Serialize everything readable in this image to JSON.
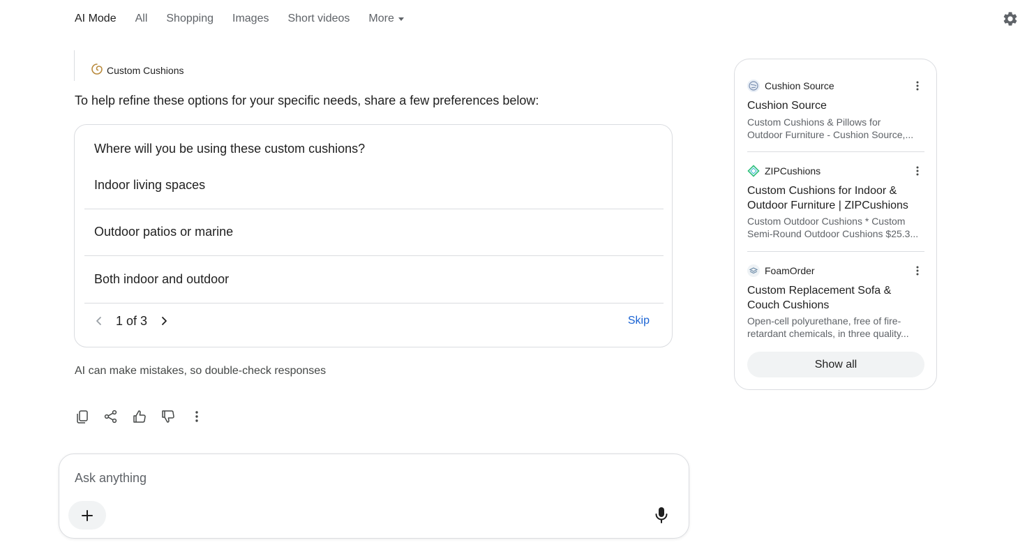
{
  "nav": {
    "tabs": [
      {
        "label": "AI Mode"
      },
      {
        "label": "All"
      },
      {
        "label": "Shopping"
      },
      {
        "label": "Images"
      },
      {
        "label": "Short videos"
      },
      {
        "label": "More"
      }
    ]
  },
  "source_chip": {
    "label": "Custom Cushions"
  },
  "intro_text": "To help refine these options for your specific needs, share a few preferences below:",
  "question": {
    "title": "Where will you be using these custom cushions?",
    "options": [
      {
        "label": "Indoor living spaces"
      },
      {
        "label": "Outdoor patios or marine"
      },
      {
        "label": "Both indoor and outdoor"
      }
    ],
    "pager_text": "1 of 3",
    "skip_label": "Skip"
  },
  "disclaimer": "AI can make mistakes, so double-check responses",
  "ask": {
    "placeholder": "Ask anything"
  },
  "sidebar": {
    "results": [
      {
        "source": "Cushion Source",
        "title": "Cushion Source",
        "snippet_line1": "Custom Cushions & Pillows for",
        "snippet_line2": "Outdoor Furniture - Cushion Source,...",
        "favicon": "globe-icon"
      },
      {
        "source": "ZIPCushions",
        "title": "Custom Cushions for Indoor & Outdoor Furniture | ZIPCushions",
        "snippet_line1": "Custom Outdoor Cushions * Custom",
        "snippet_line2": "Semi-Round Outdoor Cushions $25.3...",
        "favicon": "diamond-icon"
      },
      {
        "source": "FoamOrder",
        "title": "Custom Replacement Sofa & Couch Cushions",
        "snippet_line1": "Open-cell polyurethane, free of fire-",
        "snippet_line2": "retardant chemicals, in three quality...",
        "favicon": "layers-icon"
      }
    ],
    "show_all_label": "Show all"
  },
  "colors": {
    "link": "#1a63d3",
    "border": "#dadce0",
    "muted": "#5f6368",
    "chip_bg": "#f1f3f4"
  }
}
